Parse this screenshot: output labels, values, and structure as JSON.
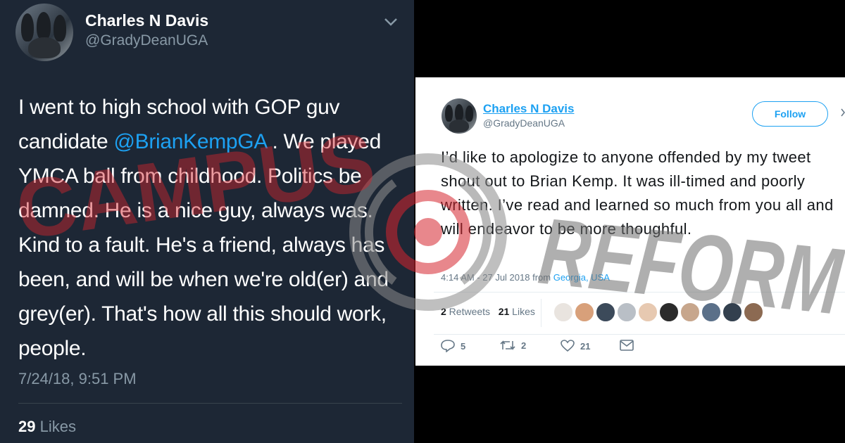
{
  "left_tweet": {
    "display_name": "Charles N Davis",
    "handle": "@GradyDeanUGA",
    "chevron_icon": "chevron-down-icon",
    "text_before_mention": "I went to high school with GOP guv candidate ",
    "mention": "@BrianKempGA",
    "text_after_mention": " . We played YMCA ball from childhood. Politics be damned. He is a nice guy, always was. Kind to a fault. He's a friend, always has been, and will be when we're old(er) and grey(er). That's how all this should work, people.",
    "timestamp": "7/24/18, 9:51 PM",
    "likes_count": "29",
    "likes_label": " Likes",
    "colors": {
      "background": "#1d2735",
      "link": "#1da1f2",
      "muted": "#8899a6"
    }
  },
  "right_tweet": {
    "display_name": "Charles N Davis",
    "handle": "@GradyDeanUGA",
    "follow_label": "Follow",
    "text": "I’d like to apologize to anyone offended by my tweet shout out to Brian Kemp. It was ill-timed and poorly written. I’ve read and learned so much from you all and will endeavor to be more thoughful.",
    "meta_time": "4:14 AM - 27 Jul 2018 from ",
    "meta_location": "Georgia, USA",
    "retweets_count": "2",
    "retweets_label": " Retweets",
    "likes_count": "21",
    "likes_label": " Likes",
    "actions": [
      {
        "icon": "reply-icon",
        "count": "5"
      },
      {
        "icon": "retweet-icon",
        "count": "2"
      },
      {
        "icon": "heart-icon",
        "count": "21"
      },
      {
        "icon": "direct-message-icon",
        "count": ""
      }
    ],
    "colors": {
      "accent": "#1da1f2",
      "text": "#14171a",
      "muted": "#657786"
    }
  },
  "watermark": {
    "word1": "CAMPUS",
    "word2": "REFORM",
    "colors": {
      "red": "#d6252e",
      "gray": "#8a8a8a"
    }
  }
}
